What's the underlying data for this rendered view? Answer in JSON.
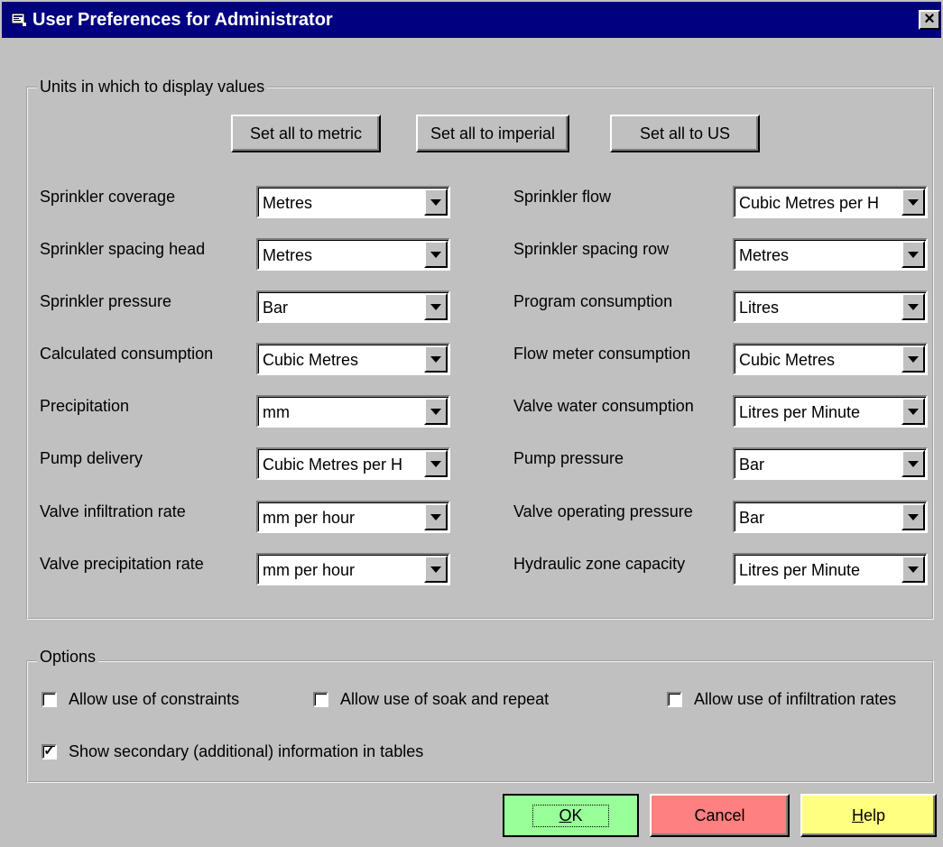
{
  "window": {
    "title": "User Preferences for Administrator",
    "close_label": "×"
  },
  "units_group": {
    "legend": "Units in which to display values",
    "buttons": {
      "metric": "Set all to metric",
      "imperial": "Set all to imperial",
      "us": "Set all to US"
    },
    "left_fields": [
      {
        "label": "Sprinkler coverage",
        "value": "Metres"
      },
      {
        "label": "Sprinkler spacing head",
        "value": "Metres"
      },
      {
        "label": "Sprinkler pressure",
        "value": "Bar"
      },
      {
        "label": "Calculated consumption",
        "value": "Cubic Metres"
      },
      {
        "label": "Precipitation",
        "value": "mm"
      },
      {
        "label": "Pump delivery",
        "value": "Cubic Metres per H"
      },
      {
        "label": "Valve infiltration rate",
        "value": "mm per hour"
      },
      {
        "label": "Valve precipitation rate",
        "value": "mm per hour"
      }
    ],
    "right_fields": [
      {
        "label": "Sprinkler flow",
        "value": "Cubic Metres per H"
      },
      {
        "label": "Sprinkler spacing row",
        "value": "Metres"
      },
      {
        "label": "Program consumption",
        "value": "Litres"
      },
      {
        "label": "Flow meter consumption",
        "value": "Cubic Metres"
      },
      {
        "label": "Valve water consumption",
        "value": "Litres per Minute"
      },
      {
        "label": "Pump pressure",
        "value": "Bar"
      },
      {
        "label": "Valve operating pressure",
        "value": "Bar"
      },
      {
        "label": "Hydraulic zone capacity",
        "value": "Litres per Minute"
      }
    ]
  },
  "options_group": {
    "legend": "Options",
    "checkboxes": [
      {
        "label": "Allow use of constraints",
        "checked": false
      },
      {
        "label": "Allow use of soak and repeat",
        "checked": false
      },
      {
        "label": "Allow use of infiltration rates",
        "checked": false
      },
      {
        "label": "Show secondary (additional) information in tables",
        "checked": true
      }
    ]
  },
  "footer": {
    "ok_accel": "O",
    "ok_rest": "K",
    "cancel_label": "Cancel",
    "help_accel": "H",
    "help_rest": "elp"
  },
  "colors": {
    "ok_button": "#99ff99",
    "cancel_button": "#ff8080",
    "help_button": "#ffff80",
    "titlebar": "#000080"
  }
}
